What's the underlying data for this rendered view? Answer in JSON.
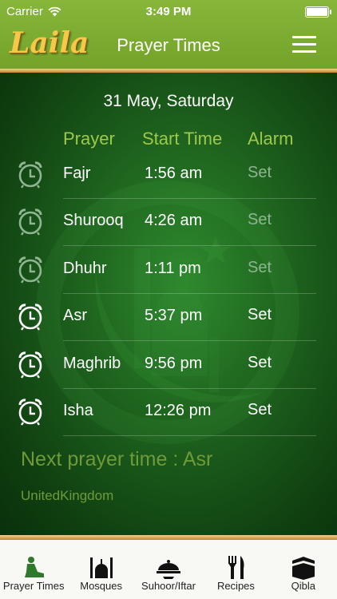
{
  "status_bar": {
    "carrier": "Carrier",
    "time": "3:49 PM"
  },
  "header": {
    "logo": "Laila",
    "title": "Prayer Times"
  },
  "date": "31 May, Saturday",
  "columns": {
    "prayer": "Prayer",
    "start_time": "Start Time",
    "alarm": "Alarm"
  },
  "prayers": [
    {
      "name": "Fajr",
      "time": "1:56 am",
      "alarm": "Set",
      "active": false
    },
    {
      "name": "Shurooq",
      "time": "4:26 am",
      "alarm": "Set",
      "active": false
    },
    {
      "name": "Dhuhr",
      "time": "1:11 pm",
      "alarm": "Set",
      "active": false
    },
    {
      "name": "Asr",
      "time": "5:37 pm",
      "alarm": "Set",
      "active": true
    },
    {
      "name": "Maghrib",
      "time": "9:56 pm",
      "alarm": "Set",
      "active": true
    },
    {
      "name": "Isha",
      "time": "12:26 pm",
      "alarm": "Set",
      "active": true
    }
  ],
  "next_prayer": "Next prayer time : Asr",
  "location": "UnitedKingdom",
  "tabs": [
    {
      "label": "Prayer Times",
      "icon": "prayer-icon",
      "active": true
    },
    {
      "label": "Mosques",
      "icon": "mosque-icon",
      "active": false
    },
    {
      "label": "Suhoor/Iftar",
      "icon": "food-dish-icon",
      "active": false
    },
    {
      "label": "Recipes",
      "icon": "fork-knife-icon",
      "active": false
    },
    {
      "label": "Qibla",
      "icon": "kaaba-icon",
      "active": false
    }
  ],
  "colors": {
    "header_green": "#7cae32",
    "gold": "#d9b25a",
    "column_header": "#9fc84a",
    "inactive_text": "#8fb592",
    "active_text": "#ffffff",
    "tab_active": "#4a8a2a"
  }
}
